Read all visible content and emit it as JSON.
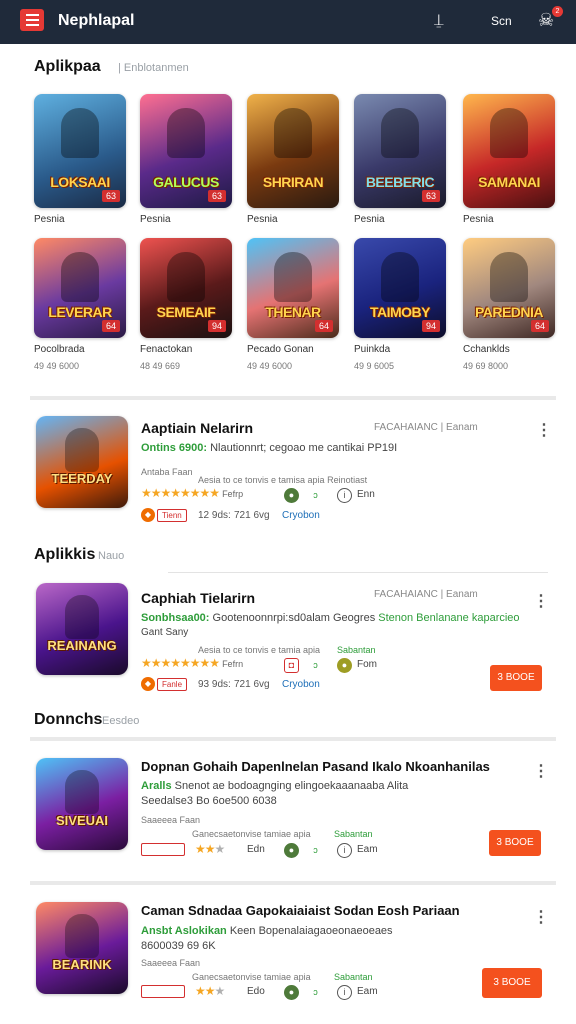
{
  "header": {
    "app_title": "Nephlapal",
    "icon_left": "antenna-icon",
    "action_text": "Scn",
    "icon_right": "crossbones-icon",
    "badge_count": "2",
    "bg_color": "#1f2a3a",
    "accent_color": "#e53935"
  },
  "section1": {
    "title": "Aplikpaa",
    "subtitle": "| Enblotanmen"
  },
  "grid": [
    {
      "art": "LOKSAAI",
      "tag": "63",
      "name": "Pesnia",
      "meta": ""
    },
    {
      "art": "GALUCUS",
      "tag": "63",
      "name": "Pesnia",
      "meta": ""
    },
    {
      "art": "SHRIRAN",
      "tag": "",
      "name": "Pesnia",
      "meta": ""
    },
    {
      "art": "BEEBERIC",
      "tag": "63",
      "name": "Pesnia",
      "meta": ""
    },
    {
      "art": "SAMANAI",
      "tag": "",
      "name": "Pesnia",
      "meta": ""
    },
    {
      "art": "LEVERAR",
      "tag": "64",
      "name": "Pocolbrada",
      "meta": "49 49 6000"
    },
    {
      "art": "SEMEAIF",
      "tag": "94",
      "name": "Fenactokan",
      "meta": "48 49 669"
    },
    {
      "art": "THENAR",
      "tag": "64",
      "name": "Pecado Gonan",
      "meta": "49 49 6000"
    },
    {
      "art": "TAIMOBY",
      "tag": "94",
      "name": "Puinkda",
      "meta": "49 9 6005"
    },
    {
      "art": "PAREDNIA",
      "tag": "64",
      "name": "Cchanklds",
      "meta": "49 69 8000"
    }
  ],
  "featured_card": {
    "art": "TEERDAY",
    "title": "Aaptiain Nelarirn",
    "right_text": "FACAHAIANC | Eanam",
    "green": "Ontins 6900:",
    "line1": "Nlautionnrt; cegoao me cantikai PP19I",
    "line2": "Antaba Faan",
    "line3": "Aesia to ce tonvis e tamisa apia Reinotiast",
    "rating_text": "Fefrp",
    "icon1_label": "",
    "icon2_label": "Enn",
    "pill": "Tienn",
    "meta1": "12 9ds:",
    "meta2": "721 6vg",
    "meta3": "Cryobon"
  },
  "section2": {
    "title": "Aplikkis",
    "subtitle": "Nauo"
  },
  "card2": {
    "art": "REAINANG",
    "title": "Caphiah Tielarirn",
    "right_text": "FACAHAIANC | Eanam",
    "green": "Sonbhsaa00:",
    "line1": "Gootenoonnrpi:sd0alam Geogres",
    "blue": "Stenon Benlanane kaparcieo",
    "line2": "Gant Sany",
    "line3": "Aesia to ce tonvis e tamia apia",
    "small_green": "Sabantan",
    "rating_text": "Fefrn",
    "icon2_label": "Fom",
    "pill": "Fanle",
    "meta1": "93 9ds:",
    "meta2": "721 6vg",
    "meta3": "Cryobon",
    "button": "3 BOOE"
  },
  "section3": {
    "title": "Donnchs",
    "subtitle": "Eesdeo"
  },
  "card3": {
    "art": "SIVEUAI",
    "title": "Dopnan Gohaih Dapenlnelan Pasand Ikalo Nkoanhanilas",
    "line1": "Snenot ae bodoagnging elingoekaaanaaba Alita",
    "green": "Aralls",
    "line2": "Seedalse3 Bo 6oe500 6038",
    "line3": "Saaeeea Faan",
    "line4": "Ganecsaetonvise tamiae apia",
    "small_green": "Sabantan",
    "icon1_label": "Edn",
    "icon2_label": "Eam",
    "button": "3 BOOE"
  },
  "card4": {
    "art": "BEARINK",
    "title": "Caman Sdnadaa Gapokaiaiaist Sodan Eosh Pariaan",
    "green": "Ansbt Aslokikan",
    "line1": "Keen Bopenalaiagaoeonaeoeaes",
    "line2": "8600039 69 6K",
    "line3": "Saaeeea Faan",
    "line4": "Ganecsaetonvise tamiae apia",
    "small_green": "Sabantan",
    "icon1_label": "Edo",
    "icon2_label": "Eam",
    "button": "3 BOOE"
  }
}
